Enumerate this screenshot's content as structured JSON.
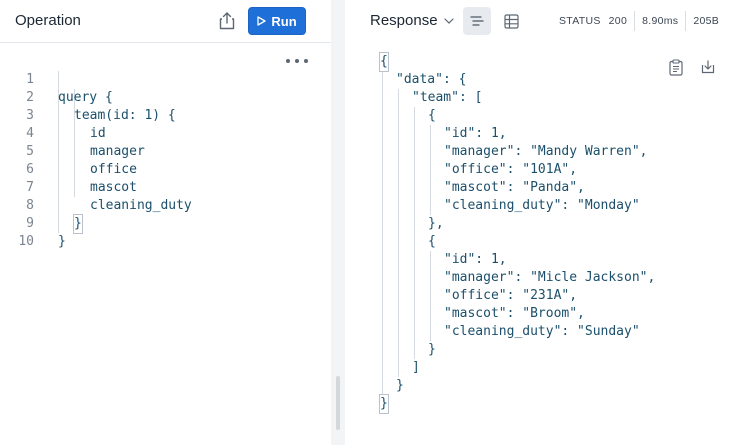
{
  "operation": {
    "title": "Operation",
    "run_label": "Run",
    "lines": [
      {
        "n": "1",
        "text": "query {"
      },
      {
        "n": "2",
        "text": "team(id: 1) {"
      },
      {
        "n": "3",
        "text": "id"
      },
      {
        "n": "4",
        "text": "manager"
      },
      {
        "n": "5",
        "text": "office"
      },
      {
        "n": "6",
        "text": "mascot"
      },
      {
        "n": "7",
        "text": "cleaning_duty"
      },
      {
        "n": "8",
        "text": "}"
      },
      {
        "n": "9",
        "text": "}"
      },
      {
        "n": "10",
        "text": ""
      }
    ]
  },
  "response": {
    "title": "Response",
    "status_label": "STATUS",
    "status_code": "200",
    "time": "8.90ms",
    "size": "205B",
    "lines": [
      "{",
      "\"data\": {",
      "\"team\": [",
      "{",
      "\"id\": 1,",
      "\"manager\": \"Mandy Warren\",",
      "\"office\": \"101A\",",
      "\"mascot\": \"Panda\",",
      "\"cleaning_duty\": \"Monday\"",
      "},",
      "{",
      "\"id\": 1,",
      "\"manager\": \"Micle Jackson\",",
      "\"office\": \"231A\",",
      "\"mascot\": \"Broom\",",
      "\"cleaning_duty\": \"Sunday\"",
      "}",
      "]",
      "}",
      "}"
    ]
  },
  "colors": {
    "run_button": "#1f6fd8",
    "splitter": "#f2f4f6"
  }
}
